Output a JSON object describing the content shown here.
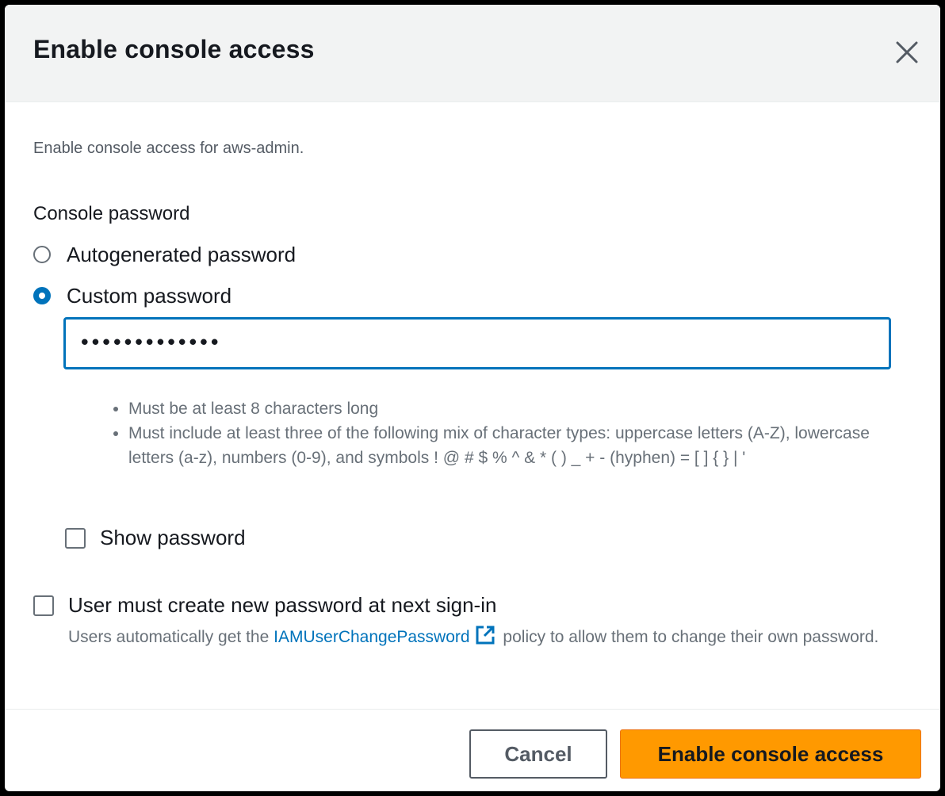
{
  "modal": {
    "title": "Enable console access",
    "description": "Enable console access for aws-admin."
  },
  "password": {
    "section_label": "Console password",
    "options": [
      {
        "label": "Autogenerated password",
        "checked": false
      },
      {
        "label": "Custom password",
        "checked": true
      }
    ],
    "value": "•••••••••••••",
    "rules": [
      "Must be at least 8 characters long",
      "Must include at least three of the following mix of character types: uppercase letters (A-Z), lowercase letters (a-z), numbers (0-9), and symbols ! @ # $ % ^ & * ( ) _ + - (hyphen) = [ ] { } | '"
    ],
    "show_password_label": "Show password",
    "show_password_checked": false
  },
  "reset": {
    "label": "User must create new password at next sign-in",
    "checked": false,
    "help_prefix": "Users automatically get the",
    "help_link": "IAMUserChangePassword",
    "help_suffix": "policy to allow them to change their own password."
  },
  "footer": {
    "cancel_label": "Cancel",
    "submit_label": "Enable console access"
  },
  "colors": {
    "accent": "#0073bb",
    "primary_button": "#ff9900",
    "header_bg": "#f2f3f3"
  },
  "icons": [
    "close-icon",
    "external-link-icon"
  ]
}
